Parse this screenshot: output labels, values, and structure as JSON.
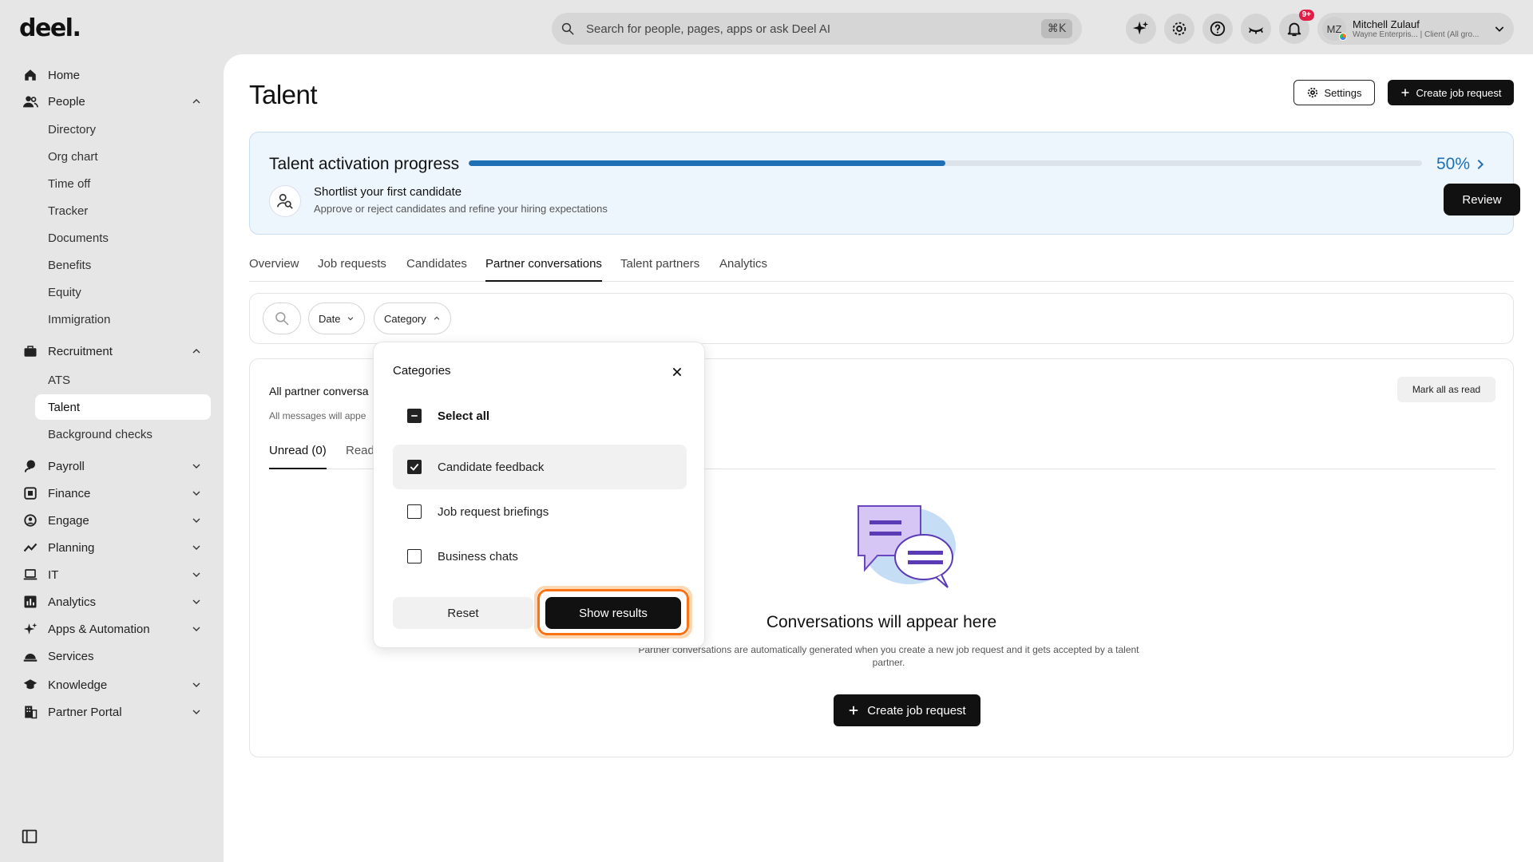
{
  "app": {
    "logo": "deel."
  },
  "search": {
    "placeholder": "Search for people, pages, apps or ask Deel AI",
    "shortcut": "⌘K"
  },
  "header": {
    "notification_badge": "9+",
    "user": {
      "initials": "MZ",
      "name": "Mitchell Zulauf",
      "subtitle": "Wayne Enterpris... | Client (All gro..."
    }
  },
  "sidebar": {
    "home": "Home",
    "people": "People",
    "people_items": [
      "Directory",
      "Org chart",
      "Time off",
      "Tracker",
      "Documents",
      "Benefits",
      "Equity",
      "Immigration"
    ],
    "recruitment": "Recruitment",
    "recruitment_items": [
      "ATS",
      "Talent",
      "Background checks"
    ],
    "payroll": "Payroll",
    "finance": "Finance",
    "engage": "Engage",
    "planning": "Planning",
    "it": "IT",
    "analytics": "Analytics",
    "apps": "Apps & Automation",
    "services": "Services",
    "knowledge": "Knowledge",
    "partner_portal": "Partner Portal"
  },
  "page": {
    "title": "Talent",
    "settings_label": "Settings",
    "create_job_label": "Create job request"
  },
  "progress": {
    "title": "Talent activation progress",
    "percent_value": 0.5,
    "percent_label": "50%",
    "step_title": "Shortlist your first candidate",
    "step_desc": "Approve or reject candidates and refine your hiring expectations",
    "review_label": "Review"
  },
  "tabs": [
    "Overview",
    "Job requests",
    "Candidates",
    "Partner conversations",
    "Talent partners",
    "Analytics"
  ],
  "filters": {
    "date": "Date",
    "category": "Category"
  },
  "conversations": {
    "title": "All partner conversa",
    "subtitle": "All messages will appe",
    "mark_all": "Mark all as read",
    "tab_unread": "Unread (0)",
    "tab_read": "Read",
    "empty_title": "Conversations will appear here",
    "empty_desc": "Partner conversations are automatically generated when you create a new job request and it gets accepted by a talent partner.",
    "create_label": "Create job request"
  },
  "categories_popup": {
    "title": "Categories",
    "select_all": "Select all",
    "options": [
      {
        "label": "Candidate feedback",
        "checked": true
      },
      {
        "label": "Job request briefings",
        "checked": false
      },
      {
        "label": "Business chats",
        "checked": false
      }
    ],
    "reset": "Reset",
    "show_results": "Show results"
  },
  "colors": {
    "accent": "#1f6fb5",
    "focus_ring": "#f97316",
    "badge": "#e11d48"
  }
}
